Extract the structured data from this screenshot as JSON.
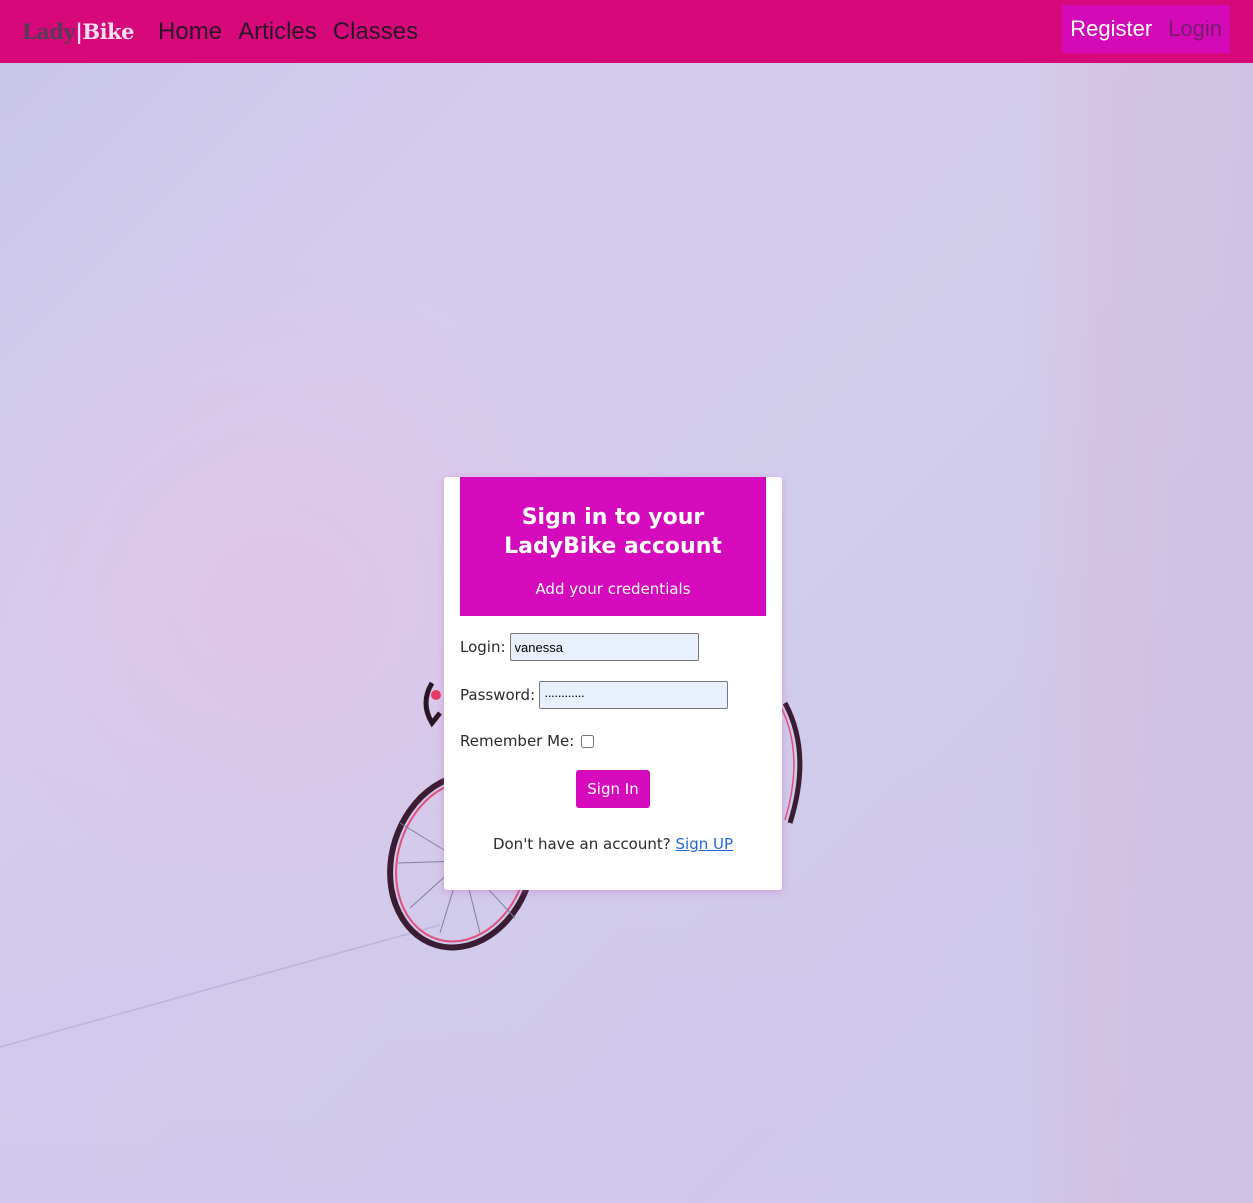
{
  "navbar": {
    "brand_lady": "Lady",
    "brand_bar": "|",
    "brand_bike": "Bike",
    "links": [
      "Home",
      "Articles",
      "Classes"
    ],
    "register": "Register",
    "login": "Login",
    "bg_color": "#d6087a",
    "accent_color": "#d40ab8"
  },
  "card": {
    "title": "Sign in to your LadyBike account",
    "subtitle": "Add your credentials",
    "login_label": "Login:",
    "login_value": "vanessa",
    "password_label": "Password:",
    "password_value": "············",
    "remember_label": "Remember Me:",
    "remember_checked": false,
    "submit_label": "Sign In",
    "no_account_text": "Don't have an account?",
    "signup_link": "Sign UP",
    "accent_color": "#d50abc"
  }
}
